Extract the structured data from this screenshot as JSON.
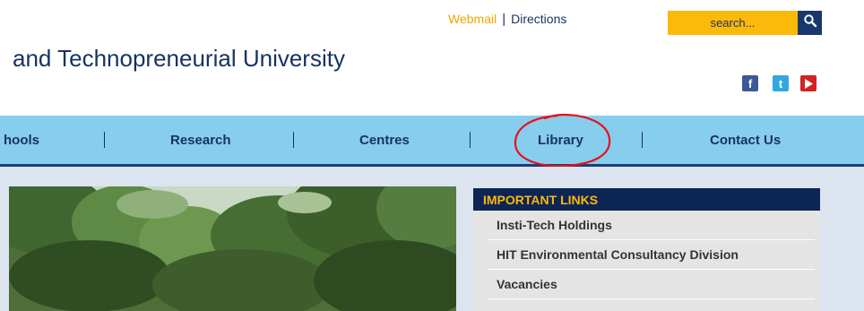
{
  "header": {
    "webmail_label": "Webmail",
    "separator": "|",
    "directions_label": "Directions",
    "search_placeholder": "search...",
    "title": "and Technopreneurial University"
  },
  "social": [
    {
      "name": "facebook-icon",
      "glyph": "f",
      "color": "#3b5998"
    },
    {
      "name": "twitter-icon",
      "glyph": "t",
      "color": "#2fa8e0"
    },
    {
      "name": "youtube-icon",
      "glyph": "▶",
      "color": "#d42121"
    }
  ],
  "nav": {
    "items": [
      "hools",
      "Research",
      "Centres",
      "Library",
      "Contact Us"
    ],
    "highlighted": "Library"
  },
  "important_links": {
    "header": "IMPORTANT LINKS",
    "items": [
      "Insti-Tech Holdings",
      "HIT Environmental Consultancy Division",
      "Vacancies"
    ]
  },
  "colors": {
    "nav_bg": "#87cdee",
    "dark_blue": "#16335f",
    "accent_orange": "#fbb90a",
    "annotation_red": "#e8101a"
  }
}
